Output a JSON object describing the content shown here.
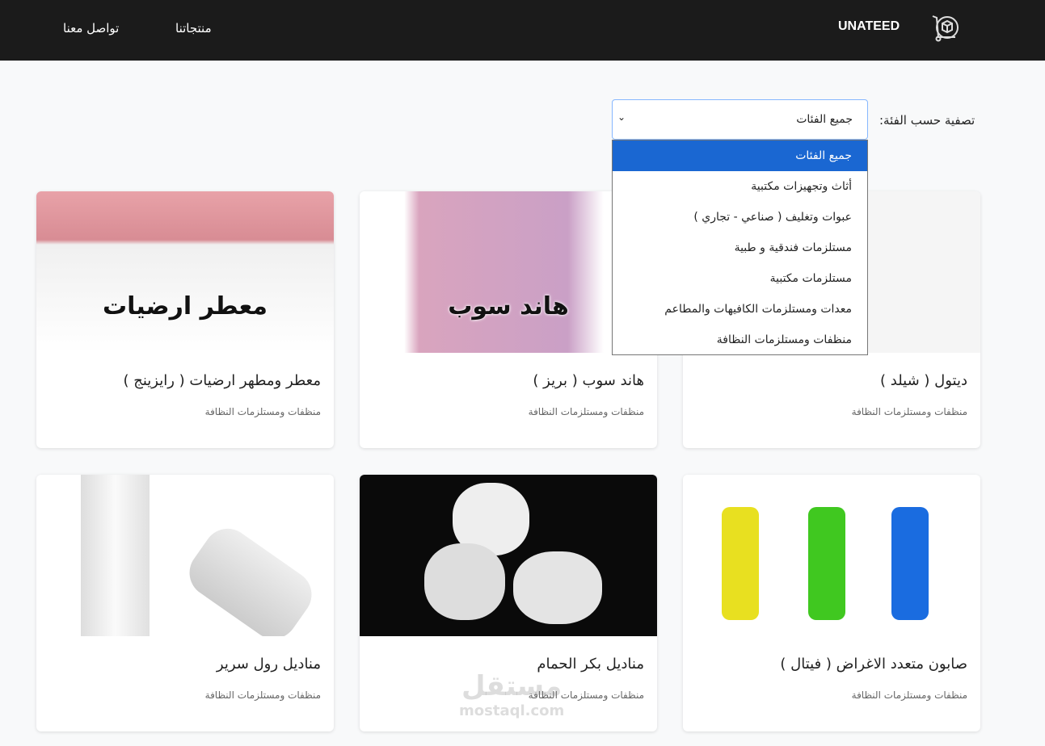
{
  "nav": {
    "brand": "UNATEED",
    "links": [
      "منتجاتنا",
      "تواصل معنا"
    ]
  },
  "filter": {
    "label": "تصفية حسب الفئة:",
    "selected": "جميع الفئات",
    "options": [
      "جميع الفئات",
      "أثاث وتجهيزات مكتبية",
      "عبوات وتغليف ( صناعي - تجاري )",
      "مستلزمات فندقية و طبية",
      "مستلزمات مكتبية",
      "معدات ومستلزمات الكافيهات والمطاعم",
      "منظفات ومستلزمات النظافة"
    ]
  },
  "products": [
    {
      "title": "ديتول ( شيلد )",
      "category": "منظفات ومستلزمات النظافة",
      "overlay": ""
    },
    {
      "title": "هاند سوب ( بريز )",
      "category": "منظفات ومستلزمات النظافة",
      "overlay": "هاند سوب"
    },
    {
      "title": "معطر ومطهر ارضيات ( رايزينج )",
      "category": "منظفات ومستلزمات النظافة",
      "overlay": "معطر ارضيات"
    },
    {
      "title": "صابون متعدد الاغراض ( فيتال )",
      "category": "منظفات ومستلزمات النظافة",
      "overlay": ""
    },
    {
      "title": "مناديل بكر الحمام",
      "category": "منظفات ومستلزمات النظافة",
      "overlay": ""
    },
    {
      "title": "مناديل رول سرير",
      "category": "منظفات ومستلزمات النظافة",
      "overlay": ""
    }
  ],
  "watermark": {
    "arabic": "مستقل",
    "latin": "mostaql.com"
  }
}
